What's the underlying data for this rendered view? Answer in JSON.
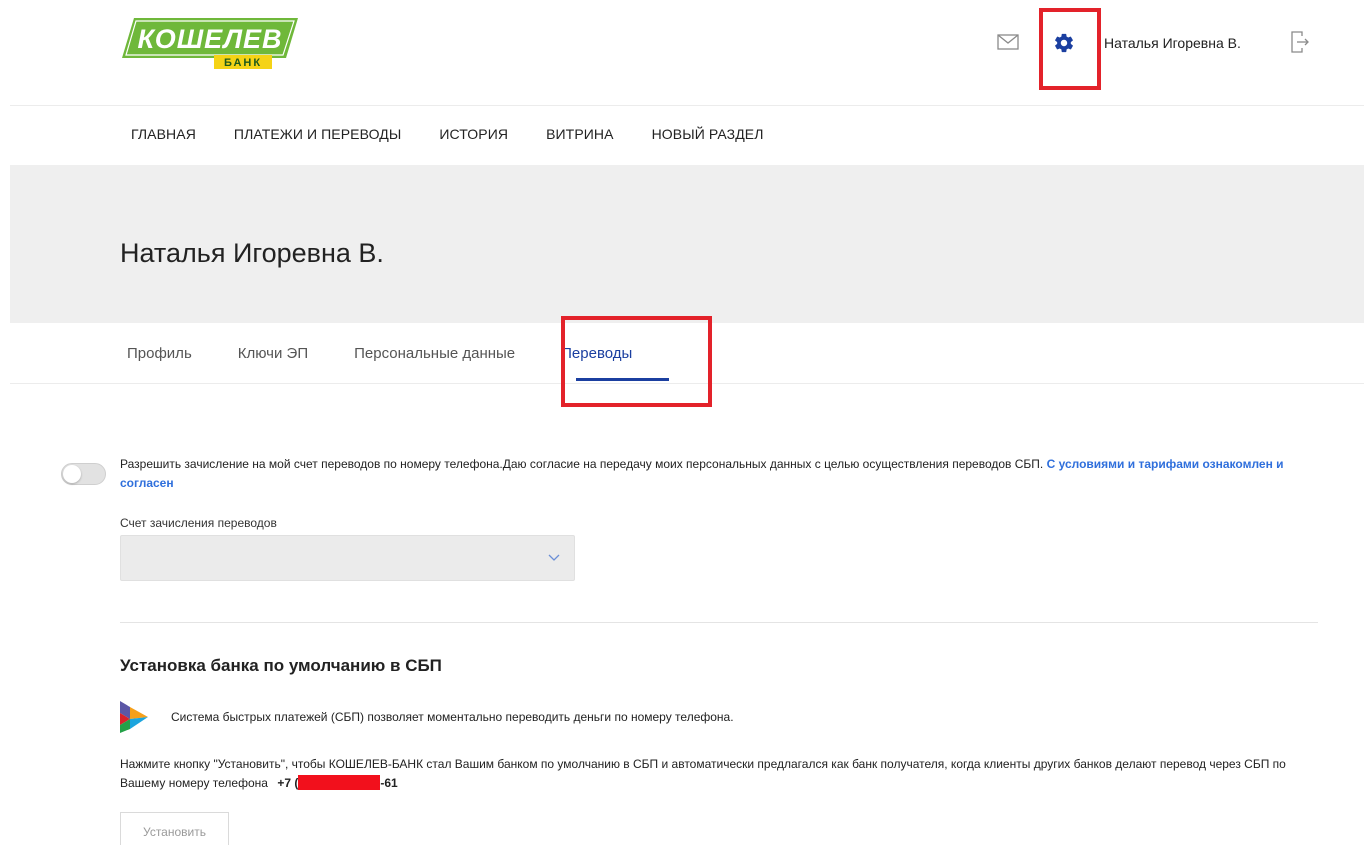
{
  "header": {
    "logo_text": "КОШЕЛЕВ",
    "logo_subtext": "БАНК",
    "user_name": "Наталья Игоревна В.",
    "icons": [
      "mail-icon",
      "gear-icon",
      "logout-icon"
    ]
  },
  "nav": {
    "items": [
      {
        "label": "ГЛАВНАЯ"
      },
      {
        "label": "ПЛАТЕЖИ И ПЕРЕВОДЫ"
      },
      {
        "label": "ИСТОРИЯ"
      },
      {
        "label": "ВИТРИНА"
      },
      {
        "label": "НОВЫЙ РАЗДЕЛ"
      }
    ]
  },
  "banner": {
    "title": "Наталья Игоревна В."
  },
  "tabs": {
    "items": [
      {
        "label": "Профиль"
      },
      {
        "label": "Ключи ЭП"
      },
      {
        "label": "Персональные данные"
      },
      {
        "label": "Переводы"
      }
    ],
    "active": "Переводы"
  },
  "consent": {
    "enabled": false,
    "text": "Разрешить зачисление на мой счет переводов по номеру телефона.Даю согласие на передачу моих персональных данных с целью осуществления переводов СБП. ",
    "link": "С условиями и тарифами ознакомлен и согласен"
  },
  "account_select": {
    "label": "Счет зачисления переводов",
    "value": ""
  },
  "sbp": {
    "title": "Установка банка по умолчанию в СБП",
    "description": "Система быстрых платежей (СБП) позволяет моментально переводить деньги по номеру телефона.",
    "instruction": "Нажмите кнопку \"Установить\", чтобы КОШЕЛЕВ-БАНК стал Вашим банком по умолчанию в СБП и автоматически предлагался как банк получателя, когда клиенты других банков делают перевод через СБП по Вашему номеру телефона",
    "phone_prefix": "+7 (",
    "phone_suffix": "-61",
    "install_label": "Установить"
  },
  "colors": {
    "accent": "#1b3fa0",
    "link": "#2f6fdc",
    "logo_green": "#6fb83a",
    "logo_yellow": "#f5d316",
    "annotation_red": "#e3222a"
  }
}
